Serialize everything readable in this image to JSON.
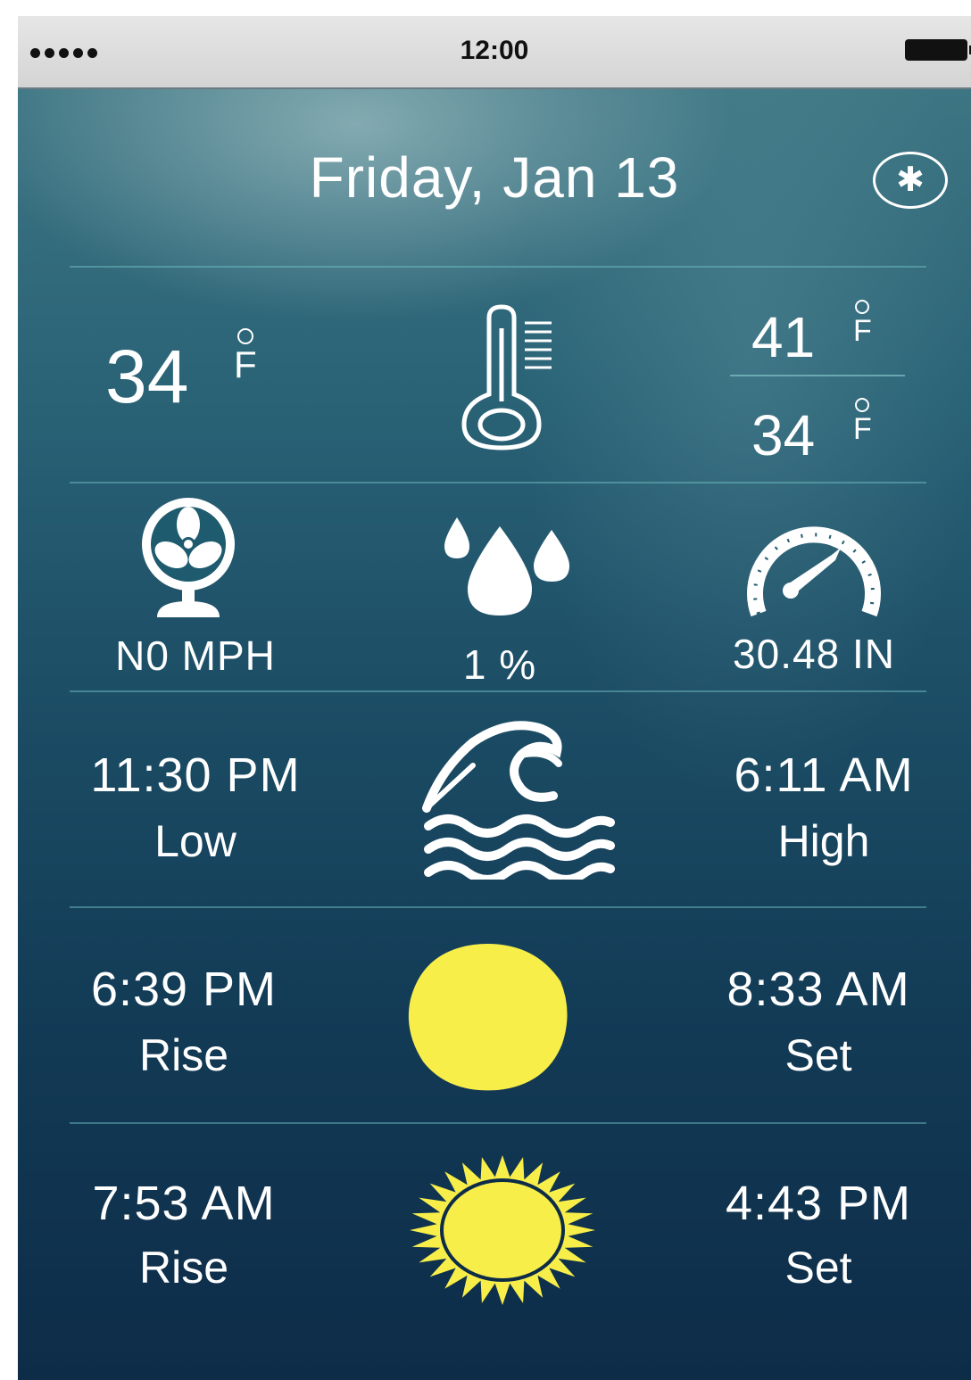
{
  "status_bar": {
    "time": "12:00",
    "signal_icon": "signal-dots-icon",
    "battery_icon": "battery-icon"
  },
  "header": {
    "date": "Friday, Jan 13",
    "close_icon": "close-circle-icon"
  },
  "temperature": {
    "current": "34",
    "current_unit": "F",
    "high": "41",
    "high_unit": "F",
    "low": "34",
    "low_unit": "F",
    "icon": "thermometer-icon"
  },
  "conditions": {
    "wind": "N0 MPH",
    "wind_icon": "fan-icon",
    "humidity": "1 %",
    "humidity_icon": "water-drops-icon",
    "pressure": "30.48 IN",
    "pressure_icon": "gauge-icon"
  },
  "tide": {
    "low_time": "11:30 PM",
    "low_label": "Low",
    "high_time": "6:11 AM",
    "high_label": "High",
    "icon": "wave-icon"
  },
  "moon": {
    "rise_time": "6:39 PM",
    "rise_label": "Rise",
    "set_time": "8:33 AM",
    "set_label": "Set",
    "icon": "moon-icon"
  },
  "sun": {
    "rise_time": "7:53 AM",
    "rise_label": "Rise",
    "set_time": "4:43 PM",
    "set_label": "Set",
    "icon": "sun-icon"
  },
  "colors": {
    "background_top": "#3d7583",
    "background_bottom": "#0d2c48",
    "accent_yellow": "#f8ee4a",
    "divider": "#78c8c8"
  }
}
